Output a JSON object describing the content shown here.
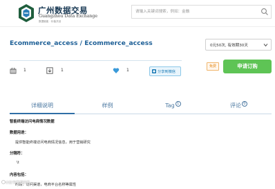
{
  "header": {
    "logo_cn": "广州数据交易",
    "logo_en": "Guangzhou Data Exchange",
    "logo_tagline": "数据赋能 · 价值共创",
    "search": {
      "placeholder": "请输入关键词搜索，例如：金融",
      "value": ""
    }
  },
  "product": {
    "title": "Ecommerce_access / Ecommerce_access",
    "price_option": "0元50次, 有效期30天",
    "stats": {
      "favorites": "1",
      "downloads": "1",
      "likes": "1"
    },
    "share_label": "分享到微信",
    "free_badge": "免费",
    "order_label": "申请订购"
  },
  "tabs": [
    {
      "label": "详细说明",
      "count": ""
    },
    {
      "label": "样例",
      "count": ""
    },
    {
      "label": "Tag",
      "count": "1"
    },
    {
      "label": "评论",
      "count": "0"
    }
  ],
  "content": {
    "title": "智能终端访问电商情况数据",
    "usage_label": "数据用途：",
    "usage_text": "提供智能终端访问电商情况信息，用于营销研究",
    "category_label": "分隔符：",
    "category_value": "\\t",
    "contains_label": "内容包括：",
    "contains_text": "时段：访问渠道，电商平台名称等属性"
  },
  "watermark": "小红书/数据交易"
}
